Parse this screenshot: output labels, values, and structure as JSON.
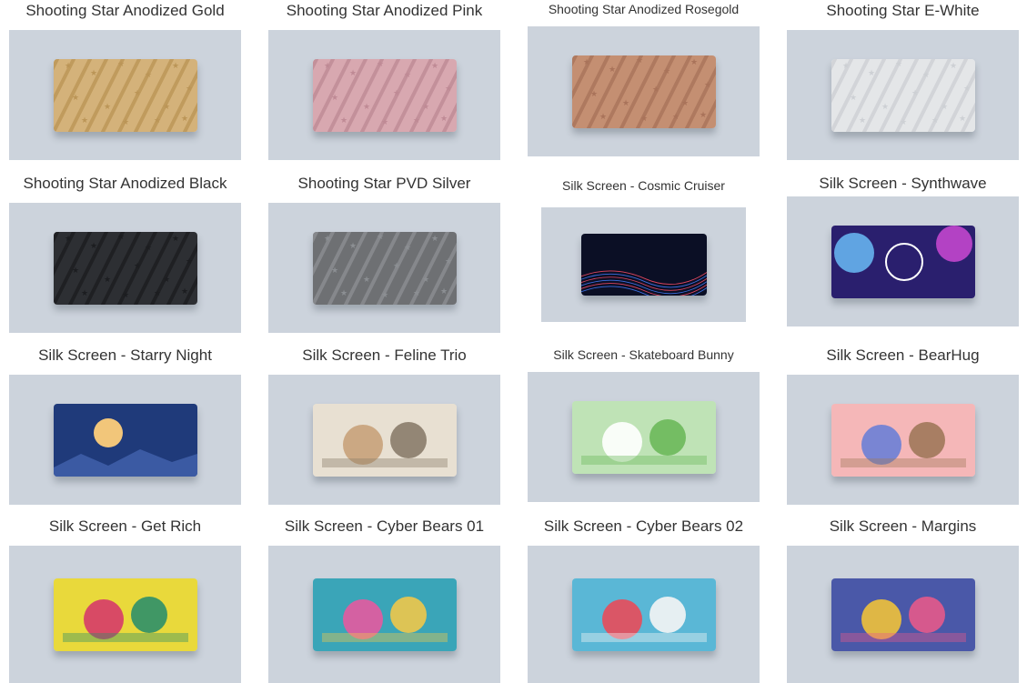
{
  "products": [
    {
      "title": "Shooting Star Anodized Gold",
      "kind": "star",
      "color": "#d4b27a",
      "stroke": "#bb9557"
    },
    {
      "title": "Shooting Star Anodized Pink",
      "kind": "star",
      "color": "#d8a8b0",
      "stroke": "#bf8a95"
    },
    {
      "title": "Shooting Star Anodized Rosegold",
      "kind": "star",
      "color": "#c48f72",
      "stroke": "#a9735a"
    },
    {
      "title": "Shooting Star E-White",
      "kind": "star",
      "color": "#e4e6e8",
      "stroke": "#cdd0d4"
    },
    {
      "title": "Shooting Star Anodized Black",
      "kind": "star",
      "color": "#2d2f33",
      "stroke": "#1c1d20"
    },
    {
      "title": "Shooting Star PVD Silver",
      "kind": "star",
      "color": "#6e7073",
      "stroke": "#8c8f93"
    },
    {
      "title": "Silk Screen - Cosmic Cruiser",
      "kind": "art",
      "bg": "#0b0f25",
      "accent": "#3b6fe0",
      "accent2": "#e0465e"
    },
    {
      "title": "Silk Screen - Synthwave",
      "kind": "art",
      "bg": "#2a1f6e",
      "accent": "#6ec6ff",
      "accent2": "#d64bd9"
    },
    {
      "title": "Silk Screen - Starry Night",
      "kind": "art",
      "bg": "#1f3a7a",
      "accent": "#f2c67a",
      "accent2": "#3b5aa3"
    },
    {
      "title": "Silk Screen - Feline Trio",
      "kind": "art",
      "bg": "#e8e0d2",
      "accent": "#c8a27a",
      "accent2": "#8a7c6a"
    },
    {
      "title": "Silk Screen - Skateboard Bunny",
      "kind": "art",
      "bg": "#bfe3b6",
      "accent": "#ffffff",
      "accent2": "#6bb85a"
    },
    {
      "title": "Silk Screen - BearHug",
      "kind": "art",
      "bg": "#f5b7b8",
      "accent": "#6b7fd6",
      "accent2": "#a0785a"
    },
    {
      "title": "Silk Screen - Get Rich",
      "kind": "art",
      "bg": "#e9d93b",
      "accent": "#d63a6a",
      "accent2": "#2e8f6a"
    },
    {
      "title": "Silk Screen - Cyber Bears 01",
      "kind": "art",
      "bg": "#3aa5b8",
      "accent": "#e55aa0",
      "accent2": "#f0c84a"
    },
    {
      "title": "Silk Screen - Cyber Bears 02",
      "kind": "art",
      "bg": "#5ab7d6",
      "accent": "#e84b5a",
      "accent2": "#f5f5f5"
    },
    {
      "title": "Silk Screen - Margins",
      "kind": "art",
      "bg": "#4a58a8",
      "accent": "#f0c23a",
      "accent2": "#e55a8a"
    }
  ]
}
